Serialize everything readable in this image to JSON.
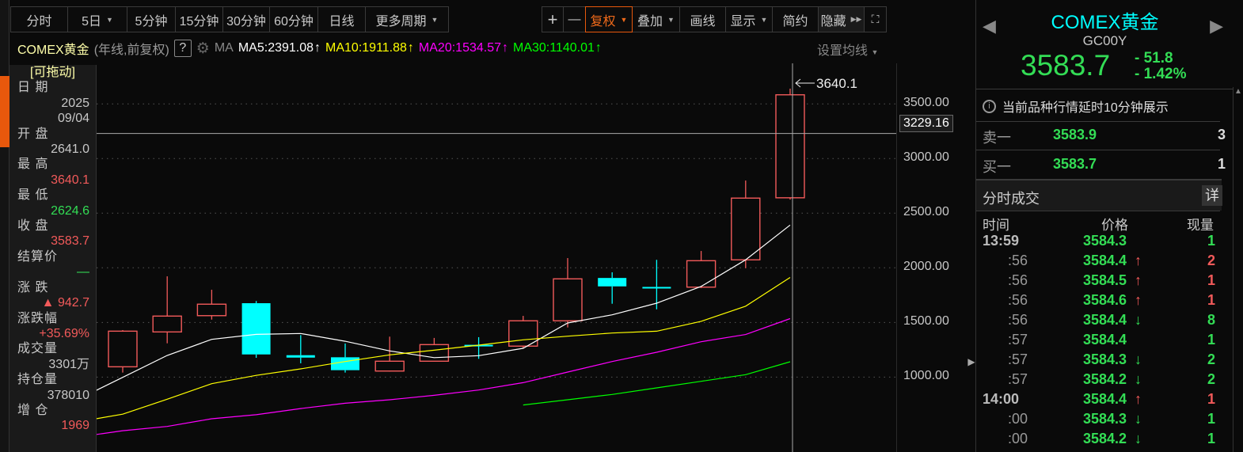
{
  "toolbar": {
    "periods": [
      "分时",
      "5日",
      "5分钟",
      "15分钟",
      "30分钟",
      "60分钟",
      "日线",
      "更多周期"
    ],
    "actions": {
      "zoom_in": "+",
      "zoom_out": "—",
      "adjust": "复权",
      "overlay": "叠加",
      "draw": "画线",
      "display": "显示",
      "simple": "简约",
      "hide": "隐藏"
    }
  },
  "ma_row": {
    "name": "COMEX黄金",
    "mode": "(年线,前复权)",
    "help": "?",
    "ma": "MA",
    "ma5": "MA5:2391.08",
    "ma10": "MA10:1911.88",
    "ma20": "MA20:1534.57",
    "ma30": "MA30:1140.01",
    "arrow": "↑",
    "settings": "设置均线"
  },
  "info": {
    "drag": "[可拖动]",
    "date_label": "日 期",
    "year": "2025",
    "date": "09/04",
    "open_label": "开 盘",
    "open": "2641.0",
    "high_label": "最 高",
    "high": "3640.1",
    "low_label": "最 低",
    "low": "2624.6",
    "close_label": "收 盘",
    "close": "3583.7",
    "settle_label": "结算价",
    "settle": "—",
    "change_label": "涨 跌",
    "change": "▲ 942.7",
    "pct_label": "涨跌幅",
    "pct": "+35.69%",
    "vol_label": "成交量",
    "vol": "3301万",
    "oi_label": "持仓量",
    "oi": "378010",
    "oi_chg_label": "增 仓",
    "oi_chg": "1969"
  },
  "chart_data": {
    "type": "candlestick",
    "yaxis_ticks": [
      "3500.00",
      "3000.00",
      "2500.00",
      "2000.00",
      "1500.00",
      "1000.00"
    ],
    "ylim": [
      430,
      3720
    ],
    "crosshair_value": "3229.16",
    "max_label": "3640.1",
    "candles": [
      {
        "o": 1094,
        "h": 1430,
        "l": 1041,
        "c": 1420
      },
      {
        "o": 1413,
        "h": 1922,
        "l": 1309,
        "c": 1558
      },
      {
        "o": 1562,
        "h": 1799,
        "l": 1526,
        "c": 1667
      },
      {
        "o": 1676,
        "h": 1696,
        "l": 1176,
        "c": 1207
      },
      {
        "o": 1200,
        "h": 1384,
        "l": 1126,
        "c": 1178
      },
      {
        "o": 1181,
        "h": 1307,
        "l": 1041,
        "c": 1063
      },
      {
        "o": 1055,
        "h": 1370,
        "l": 1050,
        "c": 1145
      },
      {
        "o": 1145,
        "h": 1358,
        "l": 1145,
        "c": 1297
      },
      {
        "o": 1295,
        "h": 1365,
        "l": 1167,
        "c": 1289
      },
      {
        "o": 1283,
        "h": 1560,
        "l": 1263,
        "c": 1515
      },
      {
        "o": 1515,
        "h": 2089,
        "l": 1454,
        "c": 1899
      },
      {
        "o": 1907,
        "h": 1959,
        "l": 1671,
        "c": 1830
      },
      {
        "o": 1825,
        "h": 2073,
        "l": 1620,
        "c": 1823
      },
      {
        "o": 1823,
        "h": 2154,
        "l": 1814,
        "c": 2065
      },
      {
        "o": 2073,
        "h": 2799,
        "l": 1997,
        "c": 2638
      },
      {
        "o": 2641,
        "h": 3640.1,
        "l": 2624.6,
        "c": 3583.7
      }
    ],
    "ma_series": [
      {
        "name": "MA5",
        "color": "#ffffff",
        "start": -1,
        "values": [
          797,
          997,
          1198,
          1345,
          1391,
          1399,
          1328,
          1239,
          1178,
          1196,
          1263,
          1495,
          1570,
          1676,
          1830,
          2073,
          2391
        ]
      },
      {
        "name": "MA10",
        "color": "#ffff00",
        "start": -1,
        "values": [
          590,
          660,
          797,
          939,
          1015,
          1075,
          1142,
          1203,
          1246,
          1292,
          1341,
          1374,
          1403,
          1420,
          1510,
          1649,
          1912
        ]
      },
      {
        "name": "MA20",
        "color": "#ff00ff",
        "start": -1,
        "values": [
          451,
          509,
          548,
          618,
          655,
          712,
          760,
          792,
          833,
          881,
          949,
          1046,
          1142,
          1227,
          1323,
          1389,
          1535
        ]
      },
      {
        "name": "MA30",
        "color": "#00ff00",
        "start": 9,
        "values": [
          744,
          792,
          841,
          901,
          961,
          1022,
          1140
        ]
      }
    ]
  },
  "quote": {
    "name": "COMEX黄金",
    "code": "GC00Y",
    "price": "3583.7",
    "change": "- 51.8",
    "pct": "- 1.42%",
    "notice": "当前品种行情延时10分钟展示",
    "ask_label": "卖一",
    "ask": "3583.9",
    "ask_vol": "3",
    "bid_label": "买一",
    "bid": "3583.7",
    "bid_vol": "1",
    "ticks_title": "分时成交",
    "detail": "详",
    "col_time": "时间",
    "col_price": "价格",
    "col_vol": "现量",
    "ticks": [
      {
        "t": "13:59",
        "p": "3584.3",
        "d": "",
        "v": "1"
      },
      {
        "t": ":56",
        "p": "3584.4",
        "d": "↑",
        "v": "2"
      },
      {
        "t": ":56",
        "p": "3584.5",
        "d": "↑",
        "v": "1"
      },
      {
        "t": ":56",
        "p": "3584.6",
        "d": "↑",
        "v": "1"
      },
      {
        "t": ":56",
        "p": "3584.4",
        "d": "↓",
        "v": "8"
      },
      {
        "t": ":57",
        "p": "3584.4",
        "d": "",
        "v": "1"
      },
      {
        "t": ":57",
        "p": "3584.3",
        "d": "↓",
        "v": "2"
      },
      {
        "t": ":57",
        "p": "3584.2",
        "d": "↓",
        "v": "2"
      },
      {
        "t": "14:00",
        "p": "3584.4",
        "d": "↑",
        "v": "1"
      },
      {
        "t": ":00",
        "p": "3584.3",
        "d": "↓",
        "v": "1"
      },
      {
        "t": ":00",
        "p": "3584.2",
        "d": "↓",
        "v": "1"
      }
    ]
  },
  "colors": {
    "up": "#f25a5a",
    "down": "#00ffff",
    "green": "#33dd55"
  }
}
